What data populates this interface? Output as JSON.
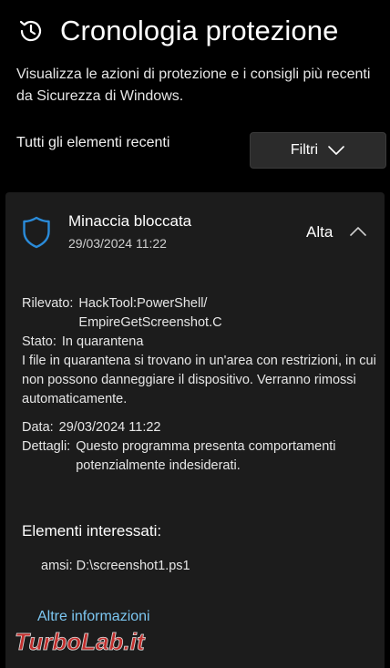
{
  "header": {
    "title": "Cronologia protezione",
    "icon": "history-icon"
  },
  "subtitle": "Visualizza le azioni di protezione e i consigli più recenti da Sicurezza di Windows.",
  "recent_label": "Tutti gli elementi recenti",
  "filter_button": {
    "label": "Filtri"
  },
  "threat": {
    "title": "Minaccia bloccata",
    "date": "29/03/2024 11:22",
    "severity": "Alta",
    "detected_label": "Rilevato:",
    "detected_value_1": "HackTool:PowerShell/",
    "detected_value_2": "EmpireGetScreenshot.C",
    "status_label": "Stato:",
    "status_value": "In quarantena",
    "quarantine_text": "I file in quarantena si trovano in un'area con restrizioni, in cui non possono danneggiare il dispositivo. Verranno rimossi automaticamente.",
    "date_label": "Data:",
    "date_value": "29/03/2024 11:22",
    "details_label": "Dettagli:",
    "details_value": "Questo programma presenta comportamenti potenzialmente indesiderati.",
    "affected_title": "Elementi interessati:",
    "affected_item": "amsi: D:\\screenshot1.ps1",
    "more_info": "Altre informazioni"
  },
  "watermark": {
    "text": "TurboLab.it"
  },
  "colors": {
    "accent": "#2a8bd9",
    "link": "#7cc7f2",
    "card": "#1c1c1c",
    "watermark": "#e0322f"
  }
}
